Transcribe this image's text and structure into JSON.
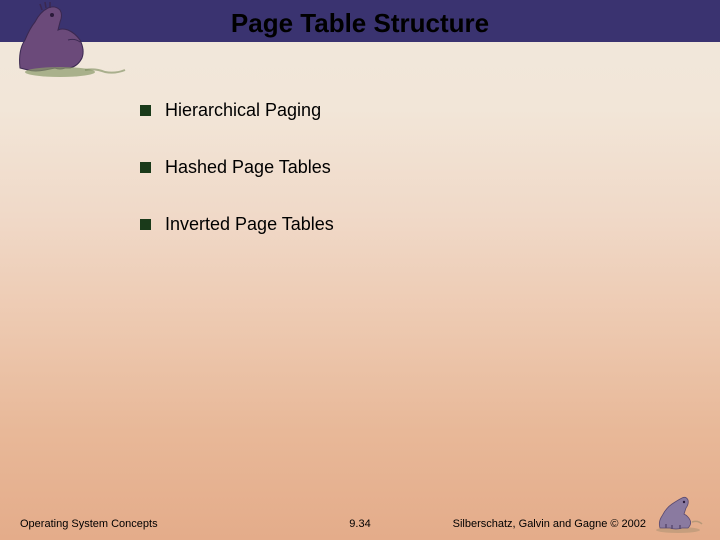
{
  "title": "Page Table Structure",
  "bullets": {
    "b0": "Hierarchical Paging",
    "b1": "Hashed Page Tables",
    "b2": "Inverted Page Tables"
  },
  "footer": {
    "left": "Operating System Concepts",
    "center": "9.34",
    "right": "Silberschatz, Galvin and Gagne © 2002"
  }
}
